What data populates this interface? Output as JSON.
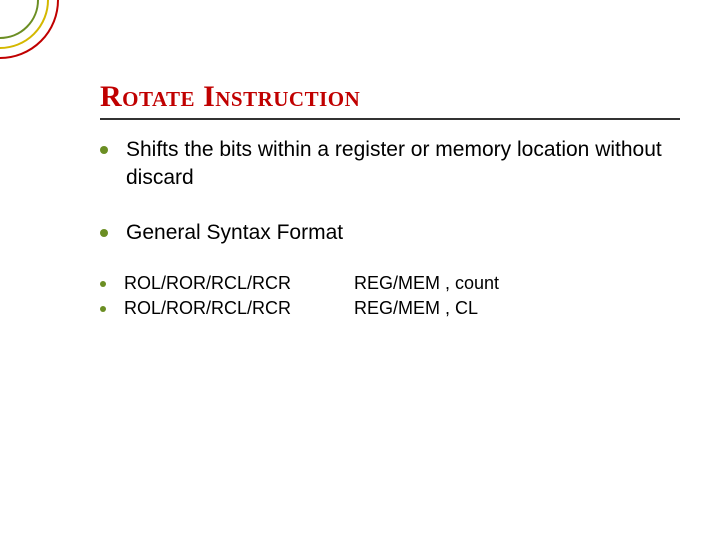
{
  "title": "Rotate Instruction",
  "bullets": {
    "b1": "Shifts the bits within a register or memory location without discard",
    "b2": "General Syntax Format"
  },
  "syntax": [
    {
      "left": "ROL/ROR/RCL/RCR",
      "right": "REG/MEM , count"
    },
    {
      "left": "ROL/ROR/RCL/RCR",
      "right": "REG/MEM , CL"
    }
  ]
}
